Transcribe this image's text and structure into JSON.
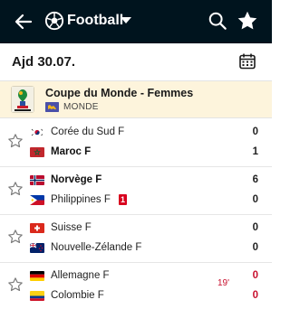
{
  "header": {
    "sport": "Football",
    "icons": {
      "back": "arrow-left-icon",
      "sport": "football-icon",
      "dropdown": "caret-down-icon",
      "search": "search-icon",
      "favorites": "star-icon"
    }
  },
  "datebar": {
    "date": "Ajd 30.07.",
    "icon": "calendar-icon"
  },
  "league": {
    "name": "Coupe du Monde - Femmes",
    "region": "MONDE",
    "region_icon": "world-flag-icon"
  },
  "matches": [
    {
      "home": {
        "name": "Corée du Sud F",
        "score": "0",
        "flag": "south-korea-flag"
      },
      "away": {
        "name": "Maroc F",
        "score": "1",
        "flag": "morocco-flag",
        "winner": true
      },
      "status": ""
    },
    {
      "home": {
        "name": "Norvège F",
        "score": "6",
        "flag": "norway-flag",
        "winner": true
      },
      "away": {
        "name": "Philippines F",
        "score": "0",
        "flag": "philippines-flag",
        "red_cards": "1"
      },
      "status": ""
    },
    {
      "home": {
        "name": "Suisse F",
        "score": "0",
        "flag": "switzerland-flag"
      },
      "away": {
        "name": "Nouvelle-Zélande F",
        "score": "0",
        "flag": "new-zealand-flag"
      },
      "status": ""
    },
    {
      "home": {
        "name": "Allemagne F",
        "score": "0",
        "flag": "germany-flag"
      },
      "away": {
        "name": "Colombie F",
        "score": "0",
        "flag": "colombia-flag"
      },
      "status": "19'",
      "live": true
    }
  ],
  "colors": {
    "header_bg": "#00141e",
    "league_bg": "#fdf4dc",
    "live": "#c8102e",
    "red_card": "#d8001e"
  }
}
